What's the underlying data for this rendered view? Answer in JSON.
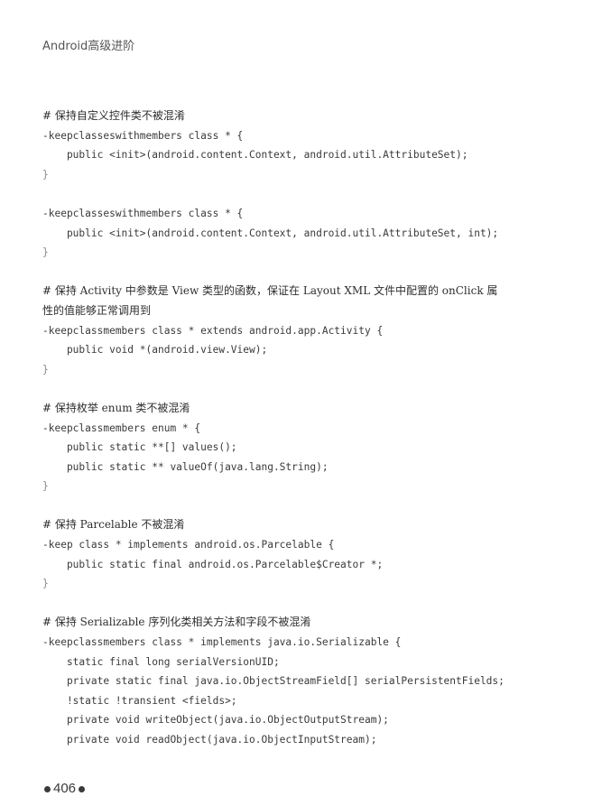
{
  "header": {
    "title": "Android高级进阶"
  },
  "code_blocks": [
    {
      "comment": "# 保持自定义控件类不被混淆",
      "lines": [
        "-keepclasseswithmembers class * {",
        "    public <init>(android.content.Context, android.util.AttributeSet);",
        "}"
      ]
    },
    {
      "comment": "",
      "lines": [
        "-keepclasseswithmembers class * {",
        "    public <init>(android.content.Context, android.util.AttributeSet, int);",
        "}"
      ]
    },
    {
      "comment": "# 保持 Activity 中参数是 View 类型的函数，保证在 Layout XML 文件中配置的 onClick 属",
      "comment_cont": "性的值能够正常调用到",
      "lines": [
        "-keepclassmembers class * extends android.app.Activity {",
        "    public void *(android.view.View);",
        "}"
      ]
    },
    {
      "comment": "# 保持枚举 enum 类不被混淆",
      "lines": [
        "-keepclassmembers enum * {",
        "    public static **[] values();",
        "    public static ** valueOf(java.lang.String);",
        "}"
      ]
    },
    {
      "comment": "# 保持 Parcelable 不被混淆",
      "lines": [
        "-keep class * implements android.os.Parcelable {",
        "    public static final android.os.Parcelable$Creator *;",
        "}"
      ]
    },
    {
      "comment": "# 保持 Serializable 序列化类相关方法和字段不被混淆",
      "lines": [
        "-keepclassmembers class * implements java.io.Serializable {",
        "    static final long serialVersionUID;",
        "    private static final java.io.ObjectStreamField[] serialPersistentFields;",
        "    !static !transient <fields>;",
        "    private void writeObject(java.io.ObjectOutputStream);",
        "    private void readObject(java.io.ObjectInputStream);"
      ]
    }
  ],
  "footer": {
    "page_number": "406"
  }
}
